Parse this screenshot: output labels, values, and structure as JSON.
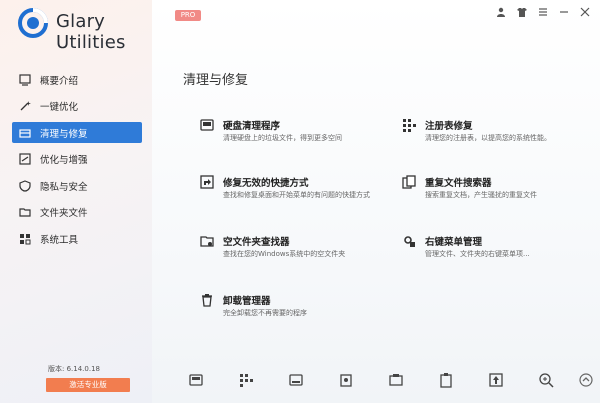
{
  "app": {
    "name": "Glary Utilities",
    "badge": "PRO"
  },
  "nav": [
    {
      "label": "概要介绍",
      "icon": "overview-icon"
    },
    {
      "label": "一键优化",
      "icon": "magic-wand-icon"
    },
    {
      "label": "清理与修复",
      "icon": "cleanup-icon",
      "active": true
    },
    {
      "label": "优化与增强",
      "icon": "optimize-icon"
    },
    {
      "label": "隐私与安全",
      "icon": "shield-icon"
    },
    {
      "label": "文件夹文件",
      "icon": "folder-icon"
    },
    {
      "label": "系统工具",
      "icon": "toolbox-icon"
    }
  ],
  "version": "版本: 6.14.0.18",
  "activate_label": "激活专业版",
  "section_title": "清理与修复",
  "tools": [
    {
      "name": "硬盘清理程序",
      "desc": "清理硬盘上的垃圾文件，得到更多空间",
      "icon": "disk-cleaner-icon"
    },
    {
      "name": "注册表修复",
      "desc": "清理您的注册表，以提高您的系统性能。",
      "icon": "registry-icon"
    },
    {
      "name": "修复无效的快捷方式",
      "desc": "查找和修复桌面和开始菜单的有问题的快捷方式",
      "icon": "shortcut-fix-icon"
    },
    {
      "name": "重复文件搜索器",
      "desc": "搜索重复文档，产生骚扰的重复文件",
      "icon": "duplicate-files-icon"
    },
    {
      "name": "空文件夹查找器",
      "desc": "查找在您的Windows系统中的空文件夹",
      "icon": "empty-folder-icon"
    },
    {
      "name": "右键菜单管理",
      "desc": "管理文件、文件夹的右键菜单项...",
      "icon": "context-menu-icon"
    },
    {
      "name": "卸载管理器",
      "desc": "完全卸载您不再需要的程序",
      "icon": "uninstall-icon"
    }
  ],
  "bottom_icons": [
    "disk-clean-icon",
    "registry-icon",
    "disk-icon",
    "duplicate-icon",
    "privacy-icon",
    "clipboard-icon",
    "upload-icon",
    "search-zoom-icon",
    "scroll-up-icon"
  ],
  "colors": {
    "accent": "#2f7bd8",
    "activate": "#f27d4f",
    "badge": "#f18a86"
  }
}
